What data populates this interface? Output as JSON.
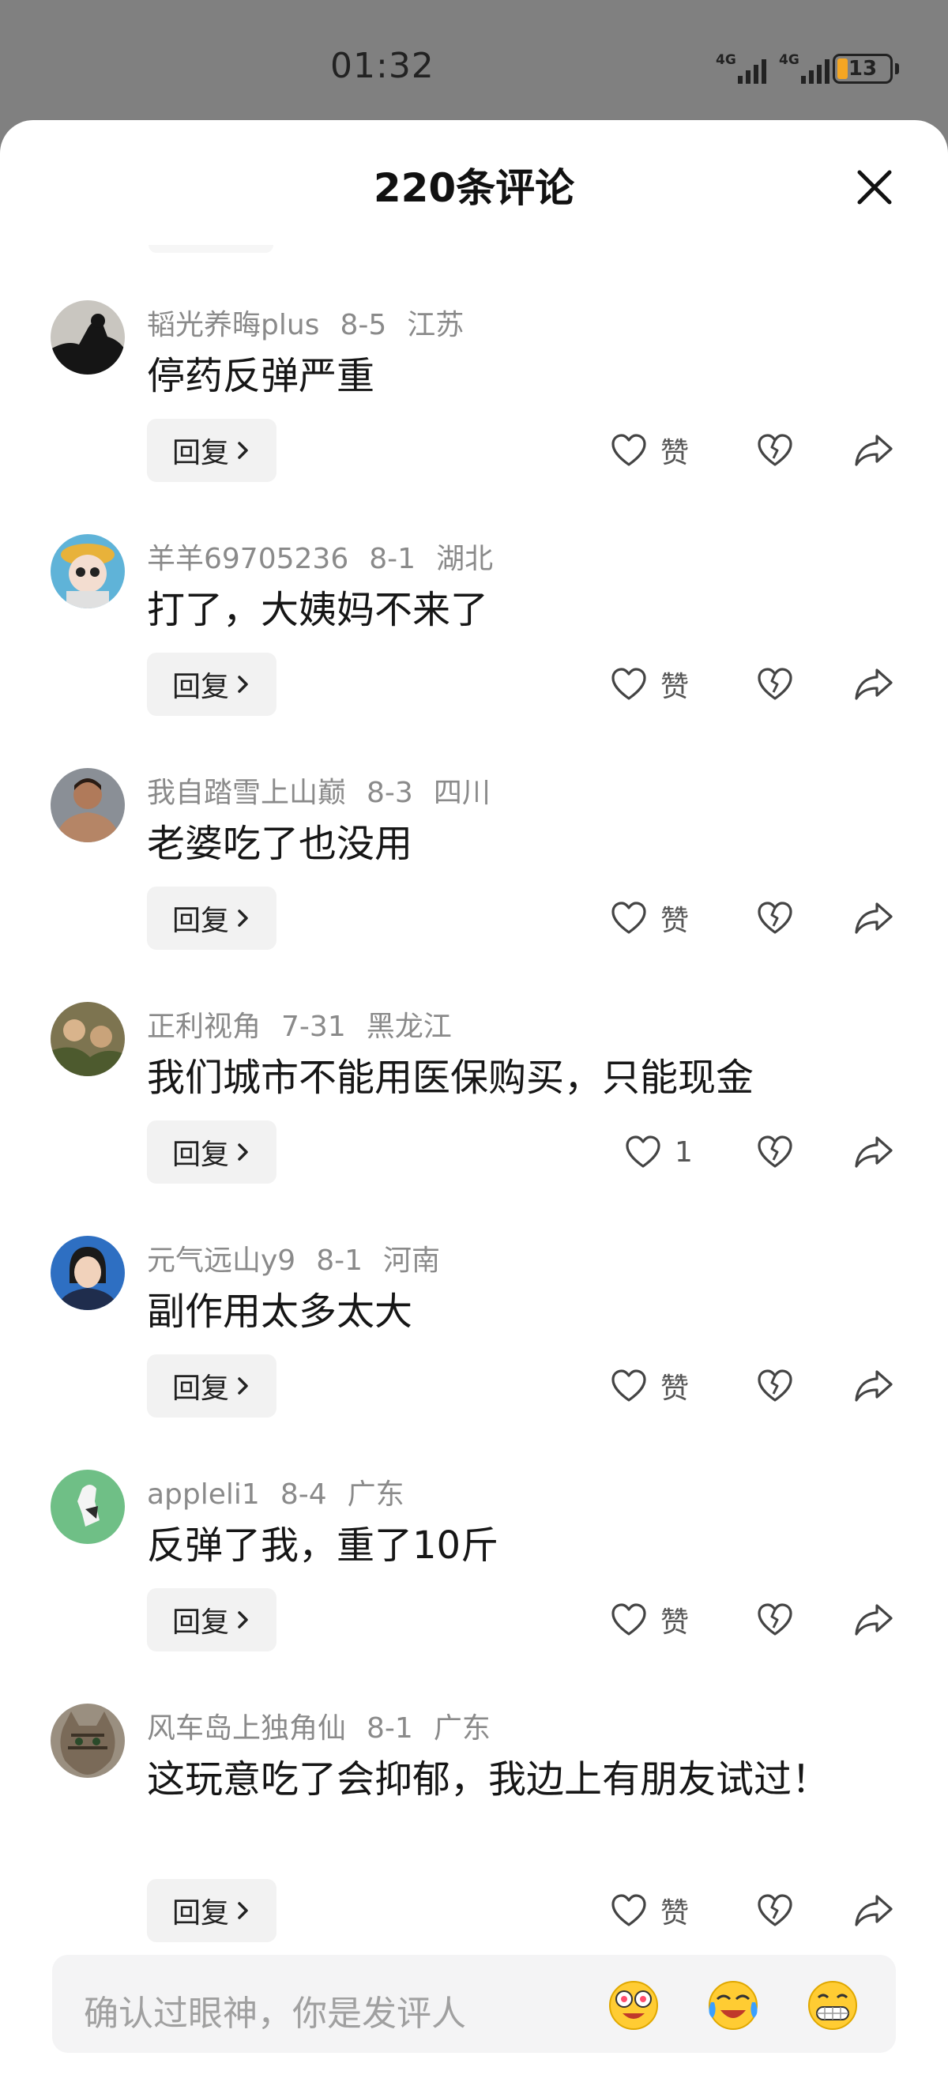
{
  "status": {
    "time": "01:32",
    "net1": "4G",
    "net2": "4G",
    "battery": "13"
  },
  "sheet": {
    "title": "220条评论"
  },
  "comments": [
    {
      "user": "韬光养晦plus",
      "date": "8-5",
      "region": "江苏",
      "text": "停药反弹严重",
      "reply": "回复",
      "like": "赞"
    },
    {
      "user": "羊羊69705236",
      "date": "8-1",
      "region": "湖北",
      "text": "打了，大姨妈不来了",
      "reply": "回复",
      "like": "赞"
    },
    {
      "user": "我自踏雪上山巅",
      "date": "8-3",
      "region": "四川",
      "text": "老婆吃了也没用",
      "reply": "回复",
      "like": "赞"
    },
    {
      "user": "正利视角",
      "date": "7-31",
      "region": "黑龙江",
      "text": "我们城市不能用医保购买，只能现金",
      "reply": "回复",
      "like": "1"
    },
    {
      "user": "元气远山y9",
      "date": "8-1",
      "region": "河南",
      "text": "副作用太多太大",
      "reply": "回复",
      "like": "赞"
    },
    {
      "user": "appleli1",
      "date": "8-4",
      "region": "广东",
      "text": "反弹了我，重了10斤",
      "reply": "回复",
      "like": "赞"
    },
    {
      "user": "风车岛上独角仙",
      "date": "8-1",
      "region": "广东",
      "text": "这玩意吃了会抑郁，我边上有朋友试过！",
      "reply": "回复",
      "like": "赞"
    }
  ],
  "input": {
    "placeholder": "确认过眼神，你是发评人"
  },
  "icons": {
    "like": "heart-outline-icon",
    "dislike": "broken-heart-icon",
    "share": "share-arrow-icon",
    "close": "close-icon",
    "chevron": "chevron-right-icon"
  }
}
